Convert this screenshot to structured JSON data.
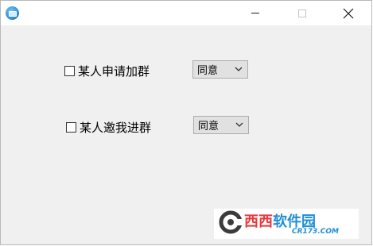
{
  "window": {
    "title": ""
  },
  "titlebar": {
    "icon": "app-icon",
    "minimize": "minimize-icon",
    "maximize": "maximize-icon",
    "close": "close-icon"
  },
  "options": [
    {
      "label": "某人申请加群",
      "checked": false,
      "select_value": "同意"
    },
    {
      "label": "某人邀我进群",
      "checked": false,
      "select_value": "同意"
    }
  ],
  "watermark": {
    "brand_red": "西西",
    "brand_blue": "软件园",
    "domain": "CR173.COM"
  },
  "colors": {
    "window_bg": "#f0f0f0",
    "titlebar_bg": "#ffffff",
    "select_bg": "#e1e1e1",
    "brand_red": "#e8383d",
    "brand_blue": "#1f8fd9"
  }
}
